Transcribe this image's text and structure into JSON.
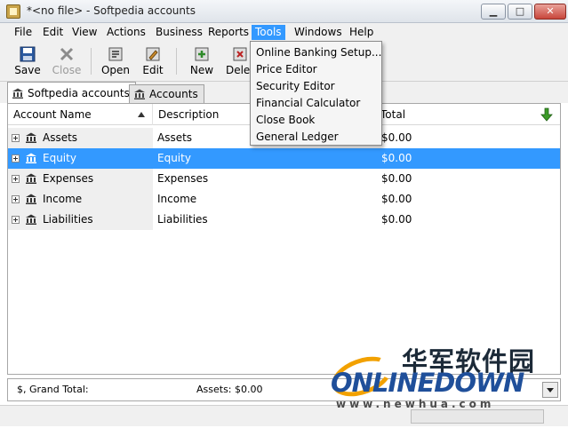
{
  "window": {
    "title": "*<no file> - Softpedia accounts",
    "buttons": {
      "minimize": "▁",
      "maximize": "□",
      "close": "✕"
    }
  },
  "menubar": {
    "items": [
      {
        "label": "File"
      },
      {
        "label": "Edit"
      },
      {
        "label": "View"
      },
      {
        "label": "Actions"
      },
      {
        "label": "Business"
      },
      {
        "label": "Reports"
      },
      {
        "label": "Tools"
      },
      {
        "label": "Windows"
      },
      {
        "label": "Help"
      }
    ],
    "active": "Tools"
  },
  "toolbar": {
    "save": "Save",
    "close": "Close",
    "open": "Open",
    "edit": "Edit",
    "new": "New",
    "delete": "Delet"
  },
  "tabs": [
    {
      "label": "Softpedia accounts",
      "selected": true
    },
    {
      "label": "Accounts",
      "selected": false
    }
  ],
  "tree": {
    "columns": {
      "account_name": "Account Name",
      "description": "Description",
      "total": "Total"
    },
    "rows": [
      {
        "name": "Assets",
        "description": "Assets",
        "total": "$0.00",
        "selected": false
      },
      {
        "name": "Equity",
        "description": "Equity",
        "total": "$0.00",
        "selected": true
      },
      {
        "name": "Expenses",
        "description": "Expenses",
        "total": "$0.00",
        "selected": false
      },
      {
        "name": "Income",
        "description": "Income",
        "total": "$0.00",
        "selected": false
      },
      {
        "name": "Liabilities",
        "description": "Liabilities",
        "total": "$0.00",
        "selected": false
      }
    ]
  },
  "summary": {
    "label": "$, Grand Total:",
    "assets": "Assets: $0.00"
  },
  "tools_menu": {
    "items": [
      "Online Banking Setup...",
      "Price Editor",
      "Security Editor",
      "Financial Calculator",
      "Close Book",
      "General Ledger"
    ]
  },
  "watermark": {
    "cn": "华军软件园",
    "logo": "ONLINEDOWN",
    "url": "www.newhua.com"
  },
  "colors": {
    "selection": "#3399ff",
    "accent_green": "#3c9a28",
    "watermark_orange": "#f2a100"
  }
}
